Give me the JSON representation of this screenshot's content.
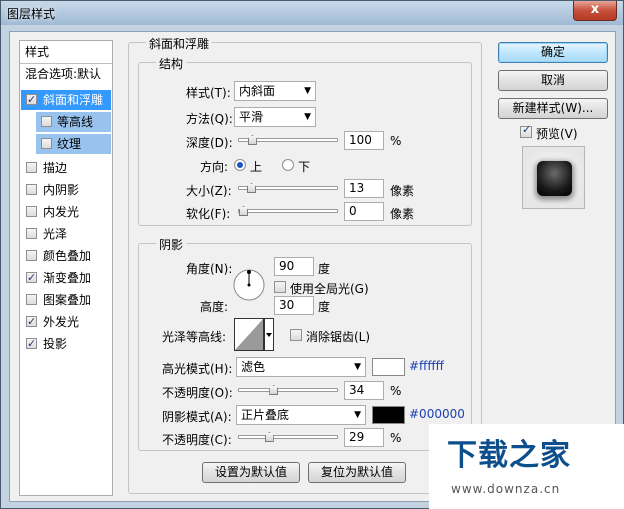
{
  "window": {
    "title": "图层样式",
    "close": "x"
  },
  "stylelist": {
    "header": "样式",
    "blend_default": "混合选项:默认",
    "items": [
      {
        "label": "斜面和浮雕",
        "checked": true
      },
      {
        "label": "等高线",
        "checked": false
      },
      {
        "label": "纹理",
        "checked": false
      },
      {
        "label": "描边",
        "checked": false
      },
      {
        "label": "内阴影",
        "checked": false
      },
      {
        "label": "内发光",
        "checked": false
      },
      {
        "label": "光泽",
        "checked": false
      },
      {
        "label": "颜色叠加",
        "checked": false
      },
      {
        "label": "渐变叠加",
        "checked": true
      },
      {
        "label": "图案叠加",
        "checked": false
      },
      {
        "label": "外发光",
        "checked": true
      },
      {
        "label": "投影",
        "checked": true
      }
    ]
  },
  "buttons": {
    "ok": "确定",
    "cancel": "取消",
    "new_style": "新建样式(W)...",
    "preview": "预览(V)",
    "set_default": "设置为默认值",
    "reset_default": "复位为默认值"
  },
  "bevel": {
    "title": "斜面和浮雕",
    "structure": "结构",
    "style_label": "样式(T):",
    "style_value": "内斜面",
    "method_label": "方法(Q):",
    "method_value": "平滑",
    "depth_label": "深度(D):",
    "depth_value": "100",
    "depth_unit": "%",
    "direction_label": "方向:",
    "dir_up": "上",
    "dir_down": "下",
    "size_label": "大小(Z):",
    "size_value": "13",
    "size_unit": "像素",
    "soften_label": "软化(F):",
    "soften_value": "0",
    "soften_unit": "像素",
    "depth_fraction": 0.1,
    "size_fraction": 0.09,
    "soften_fraction": 0.0
  },
  "shading": {
    "title": "阴影",
    "angle_label": "角度(N):",
    "angle_value": "90",
    "angle_unit": "度",
    "global_light": "使用全局光(G)",
    "altitude_label": "高度:",
    "altitude_value": "30",
    "altitude_unit": "度",
    "gloss_label": "光泽等高线:",
    "anti_alias": "消除锯齿(L)",
    "highlight_label": "高光模式(H):",
    "highlight_mode": "滤色",
    "highlight_hex": "#ffffff",
    "highlight_color": "#ffffff",
    "opacity1_label": "不透明度(O):",
    "opacity1_value": "34",
    "opacity1_unit": "%",
    "shadow_label": "阴影模式(A):",
    "shadow_mode": "正片叠底",
    "shadow_hex": "#000000",
    "shadow_color": "#000000",
    "opacity2_label": "不透明度(C):",
    "opacity2_value": "29",
    "opacity2_unit": "%",
    "opacity1_fraction": 0.34,
    "opacity2_fraction": 0.29
  },
  "watermark": {
    "title": "下载之家",
    "url": "www.downza.cn"
  }
}
